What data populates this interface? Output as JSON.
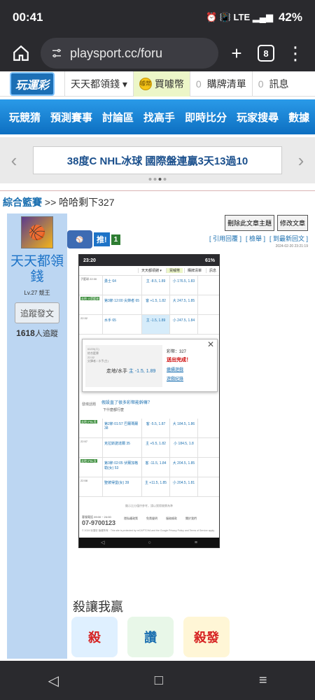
{
  "status": {
    "time": "00:41",
    "battery": "42%",
    "icons": "⏰ 📳 LTE ▂▄▆"
  },
  "browser": {
    "url": "playsport.cc/foru",
    "tab_count": "8",
    "plus": "+",
    "menu": "⋮"
  },
  "site_header": {
    "logo": "玩運彩",
    "items": [
      {
        "label": "天天都領錢 ▾"
      },
      {
        "label": "買噱幣",
        "coin": "噱幣"
      },
      {
        "count": "0",
        "label": "購牌清單"
      },
      {
        "count": "0",
        "label": "訊息"
      }
    ]
  },
  "main_nav": [
    "玩競猜",
    "預測賽事",
    "討論區",
    "找高手",
    "即時比分",
    "玩家搜尋",
    "數據"
  ],
  "banner": {
    "text": "38度C NHL冰球 國際盤連贏3天13過10",
    "prev": "‹",
    "next": "›"
  },
  "breadcrumb": {
    "section": "綜合籃賽",
    "sep": ">>",
    "title": "哈哈剩下327"
  },
  "author": {
    "name": "天天都領錢",
    "level": "Lv.27 競王",
    "follow_label": "追蹤發文",
    "follower_count": "1618",
    "follower_suffix": "人追蹤"
  },
  "post_actions": {
    "delete": "刪除此文章主題",
    "edit": "修改文章"
  },
  "post_links": {
    "quote": "[ 引用回覆 ]",
    "report": "[ 檢舉 ]",
    "latest": "[ 到最新回文 ]"
  },
  "post_date": "2024-02-20 23:21:19",
  "push": {
    "label": "推!",
    "count": "1"
  },
  "inner_shot": {
    "time": "23:20",
    "battery": "61%",
    "header": [
      "天天都領錢 ▾",
      "買噱幣",
      "購牌清單",
      "訊息"
    ],
    "rows": [
      {
        "meta": "子籃球 22:30",
        "team": "勇士 64",
        "a": "主 -8.5, 1.89",
        "b": "小 176.5, 1.83",
        "hl": false
      },
      {
        "meta": "走地 火箭籃球",
        "team": "第3節 12:00 尖鋒者 65",
        "a": "客 +1.5, 1.82",
        "b": "大 247.5, 1.85",
        "hl": false
      },
      {
        "meta": "22:32",
        "team": "水手 65",
        "a": "主 -1.5, 1.89",
        "b": "小 247.5, 1.84",
        "hl": true
      }
    ],
    "popup": {
      "date": "02/20(二)",
      "league": "綜合籃賽",
      "time": "22:32",
      "teams": "尖鋒者 / 水手(主)",
      "pick": "走地/水手",
      "pick_odds": "主 -1.5, 1.89",
      "coins": "彩幣：327",
      "done": "送出完成！",
      "continue": "繼續遊戲",
      "record": "遊戲紀錄",
      "close": "✕"
    },
    "question": "假設直了很多彩幣能幹嘛？",
    "question_sub": "下什麼都行麼",
    "question_label": "發燒話題",
    "rows2": [
      {
        "meta": "走地 IPBL男",
        "team": "第2節 01:57 巴爾瑪爾 38",
        "a": "客 -5.5, 1.87",
        "b": "大 184.5, 1.86",
        "hl": false
      },
      {
        "meta": "22:57",
        "team": "克拉斯諾達爾 35",
        "a": "主 +5.5, 1.82",
        "b": "小 184.5, 1.8",
        "hl": false
      },
      {
        "meta": "走地 IPBL女",
        "team": "第3節 02:05 伏爾加格勒(女) 53",
        "a": "客 -11.5, 1.84",
        "b": "大 204.5, 1.85",
        "hl": false
      },
      {
        "meta": "22:58",
        "team": "聖彼得堡(女) 39",
        "a": "主 +11.5, 1.85",
        "b": "小 204.5, 1.81",
        "hl": false
      }
    ],
    "foot": "顯示比分僅供參考，請以實際開賽為準",
    "phone": "07-9700123",
    "phone_label": "客服電話 09:00 ~ 24:00",
    "footer_links": [
      "隱私權政策",
      "免責聲明",
      "服務條款",
      "關於我們"
    ],
    "copyright": "© 2024 玩運彩 版權所有 · This site is protected by reCAPTCHA and the Google Privacy Policy and Terms of Service apply.",
    "nav": [
      "◁",
      "○",
      "≡"
    ]
  },
  "section_title": "殺讓我贏",
  "stickers": [
    "殺",
    "讚",
    "殺發"
  ],
  "android_nav": [
    "◁",
    "□",
    "≡"
  ]
}
